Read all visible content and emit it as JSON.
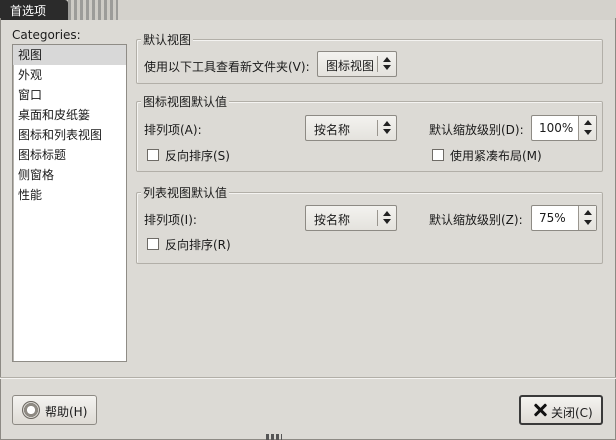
{
  "window": {
    "title": "首选项"
  },
  "categories": {
    "label": "Categories:",
    "items": [
      {
        "label": "视图",
        "selected": true
      },
      {
        "label": "外观",
        "selected": false
      },
      {
        "label": "窗口",
        "selected": false
      },
      {
        "label": "桌面和皮纸篓",
        "selected": false
      },
      {
        "label": "图标和列表视图",
        "selected": false
      },
      {
        "label": "图标标题",
        "selected": false
      },
      {
        "label": "侧窗格",
        "selected": false
      },
      {
        "label": "性能",
        "selected": false
      }
    ]
  },
  "default_view": {
    "title": "默认视图",
    "label": "使用以下工具查看新文件夹(V):",
    "value": "图标视图"
  },
  "icon_view": {
    "title": "图标视图默认值",
    "sort_label": "排列项(A):",
    "sort_value": "按名称",
    "zoom_label": "默认缩放级别(D):",
    "zoom_value": "100%",
    "reverse_label": "反向排序(S)",
    "reverse_checked": false,
    "compact_label": "使用紧凑布局(M)",
    "compact_checked": false
  },
  "list_view": {
    "title": "列表视图默认值",
    "sort_label": "排列项(I):",
    "sort_value": "按名称",
    "zoom_label": "默认缩放级别(Z):",
    "zoom_value": "75%",
    "reverse_label": "反向排序(R)",
    "reverse_checked": false
  },
  "buttons": {
    "help_label": "帮助(H)",
    "close_label": "关闭(C)"
  },
  "icons": {
    "help": "help-icon",
    "close": "close-icon"
  }
}
